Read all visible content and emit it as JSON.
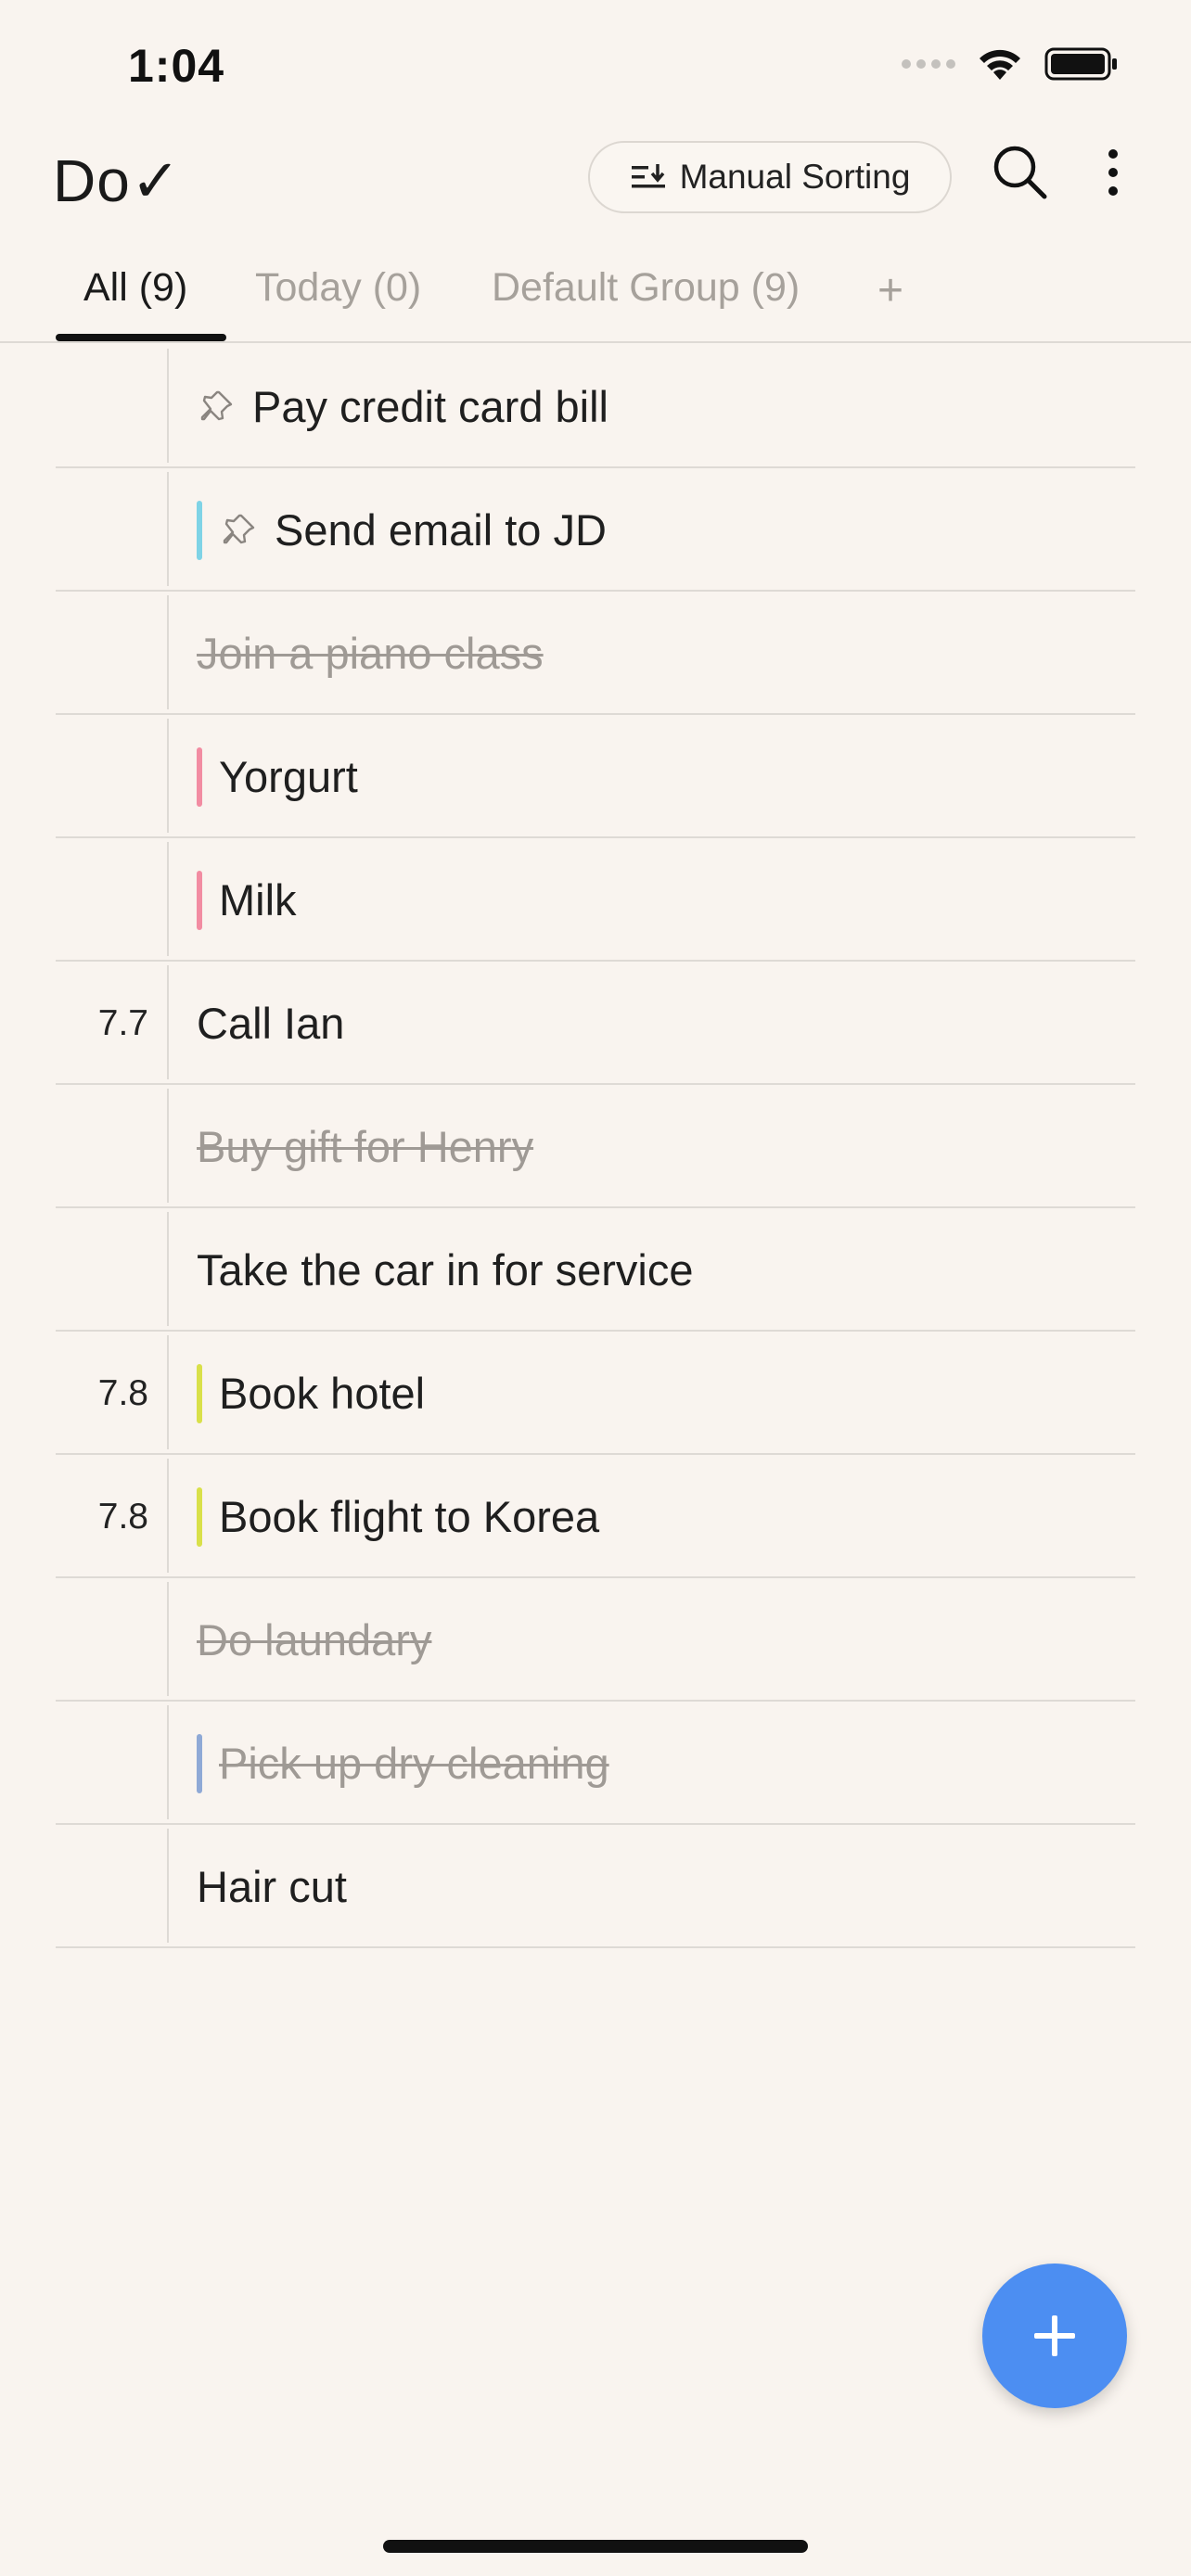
{
  "status_bar": {
    "time": "1:04"
  },
  "header": {
    "title": "Do✓",
    "sort_label": "Manual Sorting"
  },
  "tabs": [
    {
      "label": "All (9)",
      "active": true
    },
    {
      "label": "Today (0)",
      "active": false
    },
    {
      "label": "Default Group (9)",
      "active": false
    }
  ],
  "add_tab_label": "+",
  "colors": {
    "accent": "#4c8ef2",
    "cyan": "#7fd3e6",
    "pink": "#f28ca2",
    "yellow": "#d9e04a",
    "blue": "#8fa9d6"
  },
  "tasks": [
    {
      "title": "Pay credit card bill",
      "pinned": true,
      "done": false,
      "score": "",
      "color": ""
    },
    {
      "title": "Send email to JD",
      "pinned": true,
      "done": false,
      "score": "",
      "color": "#7fd3e6"
    },
    {
      "title": "Join a piano class",
      "pinned": false,
      "done": true,
      "score": "",
      "color": ""
    },
    {
      "title": "Yorgurt",
      "pinned": false,
      "done": false,
      "score": "",
      "color": "#f28ca2"
    },
    {
      "title": "Milk",
      "pinned": false,
      "done": false,
      "score": "",
      "color": "#f28ca2"
    },
    {
      "title": "Call Ian",
      "pinned": false,
      "done": false,
      "score": "7.7",
      "color": ""
    },
    {
      "title": "Buy gift for Henry",
      "pinned": false,
      "done": true,
      "score": "",
      "color": ""
    },
    {
      "title": "Take the car in for service",
      "pinned": false,
      "done": false,
      "score": "",
      "color": ""
    },
    {
      "title": "Book hotel",
      "pinned": false,
      "done": false,
      "score": "7.8",
      "color": "#d9e04a"
    },
    {
      "title": "Book flight to Korea",
      "pinned": false,
      "done": false,
      "score": "7.8",
      "color": "#d9e04a"
    },
    {
      "title": "Do laundary",
      "pinned": false,
      "done": true,
      "score": "",
      "color": ""
    },
    {
      "title": "Pick up dry cleaning",
      "pinned": false,
      "done": true,
      "score": "",
      "color": "#8fa9d6"
    },
    {
      "title": "Hair cut",
      "pinned": false,
      "done": false,
      "score": "",
      "color": ""
    }
  ]
}
